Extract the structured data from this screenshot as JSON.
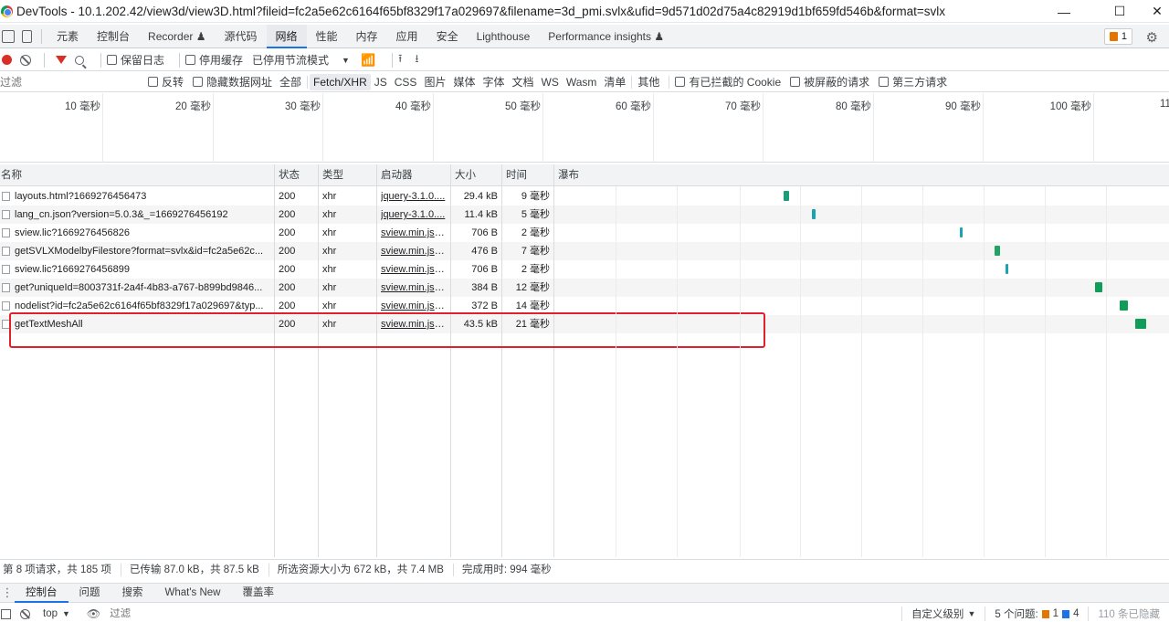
{
  "window": {
    "title": "DevTools - 10.1.202.42/view3d/view3D.html?fileid=fc2a5e62c6164f65bf8329f17a029697&filename=3d_pmi.svlx&ufid=9d571d02d75a4c82919d1bf659fd546b&format=svlx",
    "minimize": "—",
    "maximize": "☐",
    "close": "✕"
  },
  "tabs": [
    "元素",
    "控制台",
    "Recorder ♟",
    "源代码",
    "网络",
    "性能",
    "内存",
    "应用",
    "安全",
    "Lighthouse",
    "Performance insights ♟"
  ],
  "active_tab": "网络",
  "issues_count": "1",
  "toolbar": {
    "preserve_log": "保留日志",
    "disable_cache": "停用缓存",
    "throttle": "已停用节流模式"
  },
  "filter": {
    "placeholder": "过滤",
    "invert": "反转",
    "hide_data_urls": "隐藏数据网址",
    "types": [
      "全部",
      "Fetch/XHR",
      "JS",
      "CSS",
      "图片",
      "媒体",
      "字体",
      "文档",
      "WS",
      "Wasm",
      "清单",
      "其他"
    ],
    "active_type": "Fetch/XHR",
    "blocked_cookies": "有已拦截的 Cookie",
    "blocked_requests": "被屏蔽的请求",
    "third_party": "第三方请求"
  },
  "overview_ticks": [
    "10 毫秒",
    "20 毫秒",
    "30 毫秒",
    "40 毫秒",
    "50 毫秒",
    "60 毫秒",
    "70 毫秒",
    "80 毫秒",
    "90 毫秒",
    "100 毫秒",
    "11"
  ],
  "columns": {
    "name": "名称",
    "status": "状态",
    "type": "类型",
    "initiator": "启动器",
    "size": "大小",
    "time": "时间",
    "waterfall": "瀑布"
  },
  "rows": [
    {
      "name": "layouts.html?1669276456473",
      "status": "200",
      "type": "xhr",
      "initiator": "jquery-3.1.0....",
      "size": "29.4 kB",
      "time": "9 毫秒",
      "bar": {
        "start": 0.826,
        "width": 0.006,
        "color": "#1a9e7a"
      }
    },
    {
      "name": "lang_cn.json?version=5.0.3&_=1669276456192",
      "status": "200",
      "type": "xhr",
      "initiator": "jquery-3.1.0....",
      "size": "11.4 kB",
      "time": "5 毫秒",
      "bar": {
        "start": 0.854,
        "width": 0.004,
        "color": "#1aa3b0"
      }
    },
    {
      "name": "sview.lic?1669276456826",
      "status": "200",
      "type": "xhr",
      "initiator": "sview.min.js?...",
      "size": "706 B",
      "time": "2 毫秒",
      "bar": {
        "start": 1.0,
        "width": 0.003,
        "color": "#1aa3b0"
      }
    },
    {
      "name": "getSVLXModelbyFilestore?format=svlx&id=fc2a5e62c...",
      "status": "200",
      "type": "xhr",
      "initiator": "sview.min.js?...",
      "size": "476 B",
      "time": "7 毫秒",
      "bar": {
        "start": 1.034,
        "width": 0.006,
        "color": "#21a366"
      }
    },
    {
      "name": "sview.lic?1669276456899",
      "status": "200",
      "type": "xhr",
      "initiator": "sview.min.js?...",
      "size": "706 B",
      "time": "2 毫秒",
      "bar": {
        "start": 1.045,
        "width": 0.002,
        "color": "#1aa3b0"
      }
    },
    {
      "name": "get?uniqueId=8003731f-2a4f-4b83-a767-b899bd9846...",
      "status": "200",
      "type": "xhr",
      "initiator": "sview.min.js?...",
      "size": "384 B",
      "time": "12 毫秒",
      "bar": {
        "start": 1.133,
        "width": 0.008,
        "color": "#0f9d58"
      }
    },
    {
      "name": "nodelist?id=fc2a5e62c6164f65bf8329f17a029697&typ...",
      "status": "200",
      "type": "xhr",
      "initiator": "sview.min.js?...",
      "size": "372 B",
      "time": "14 毫秒",
      "bar": {
        "start": 1.158,
        "width": 0.009,
        "color": "#0f9d58"
      }
    },
    {
      "name": "getTextMeshAll",
      "status": "200",
      "type": "xhr",
      "initiator": "sview.min.js?...",
      "size": "43.5 kB",
      "time": "21 毫秒",
      "bar": {
        "start": 1.173,
        "width": 0.012,
        "color": "#0f9d58"
      }
    }
  ],
  "status": {
    "requests": "第 8 项请求，共 185 项",
    "transferred": "已传输 87.0 kB，共 87.5 kB",
    "resources": "所选资源大小为 672 kB，共 7.4 MB",
    "finish": "完成用时: 994 毫秒"
  },
  "drawer_tabs": [
    "控制台",
    "问题",
    "搜索",
    "What's New",
    "覆盖率"
  ],
  "drawer_active": "控制台",
  "console": {
    "context": "top",
    "filter_placeholder": "过滤",
    "levels": "自定义级别",
    "issues_label": "5 个问题:",
    "issues_orange": "1",
    "issues_blue": "4",
    "hidden": "110 条已隐藏"
  }
}
